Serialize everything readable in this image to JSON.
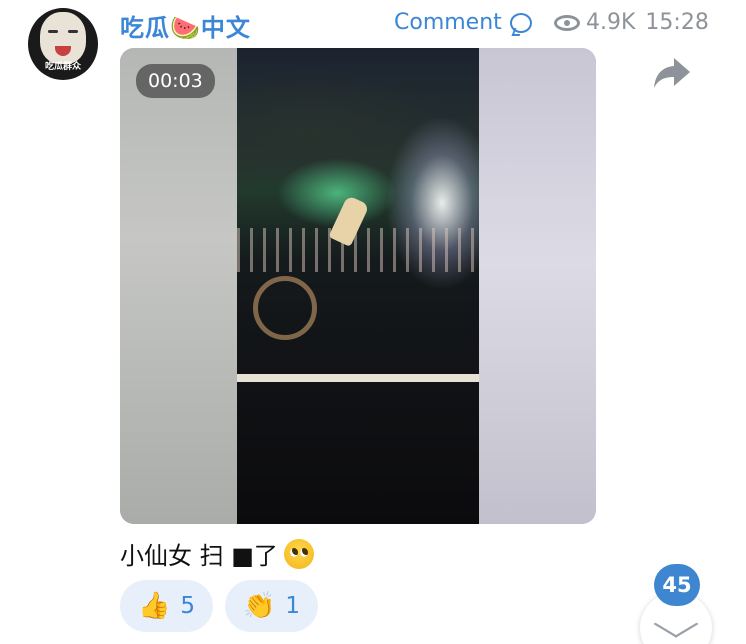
{
  "channel": {
    "title": "吃瓜🍉中文",
    "avatar_caption": "吃瓜群众"
  },
  "header": {
    "comment_label": "Comment",
    "views": "4.9K",
    "time": "15:28"
  },
  "video": {
    "duration": "00:03"
  },
  "message": {
    "caption": "小仙女 扫 ■了"
  },
  "reactions": [
    {
      "emoji": "👍",
      "count": "5"
    },
    {
      "emoji": "👏",
      "count": "1"
    }
  ],
  "comments_badge": "45",
  "colors": {
    "accent": "#3b86d6",
    "reaction_bg": "#e7f0fa",
    "muted": "#8e9399"
  },
  "icons": [
    "comment-icon",
    "eye-icon",
    "share-icon",
    "chevron-down-icon",
    "pleading-face-icon"
  ]
}
